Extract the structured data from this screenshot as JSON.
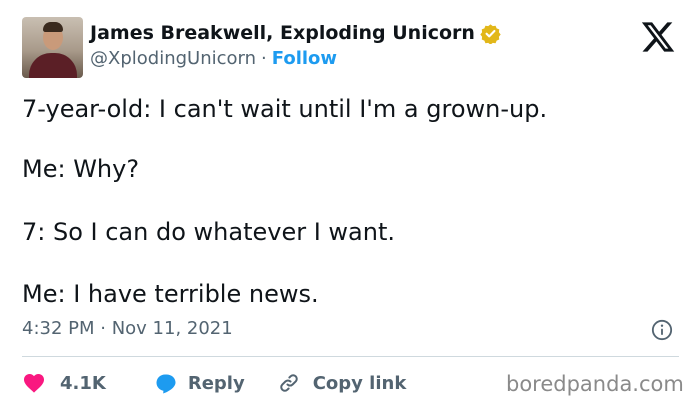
{
  "author": {
    "name": "James Breakwell, Exploding Unicorn",
    "handle": "@XplodingUnicorn",
    "separator": "·",
    "follow_label": "Follow",
    "verified_icon": "verified-badge-icon"
  },
  "tweet": {
    "lines": [
      "7-year-old: I can't wait until I'm a grown-up.",
      "Me: Why?",
      "7: So I can do whatever I want.",
      "Me: I have terrible news."
    ],
    "timestamp": "4:32 PM · Nov 11, 2021"
  },
  "actions": {
    "likes": "4.1K",
    "reply_label": "Reply",
    "copy_link_label": "Copy link"
  },
  "watermark": "boredpanda.com",
  "colors": {
    "accent": "#1d9bf0",
    "heart": "#f91880",
    "verified": "#e2b719",
    "muted": "#536471"
  }
}
